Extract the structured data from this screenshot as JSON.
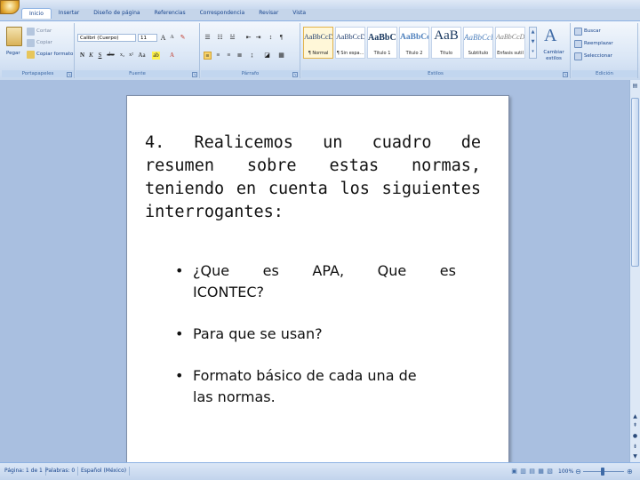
{
  "tabs": [
    "Inicio",
    "Insertar",
    "Diseño de página",
    "Referencias",
    "Correspondencia",
    "Revisar",
    "Vista"
  ],
  "active_tab": 0,
  "clipboard": {
    "paste": "Pegar",
    "cut": "Cortar",
    "copy": "Copiar",
    "format_painter": "Copiar formato",
    "label": "Portapapeles"
  },
  "font": {
    "name": "Calibri (Cuerpo)",
    "size": "11",
    "label": "Fuente"
  },
  "paragraph": {
    "label": "Párrafo"
  },
  "styles": {
    "label": "Estilos",
    "items": [
      {
        "sample": "AaBbCcDc",
        "name": "¶ Normal"
      },
      {
        "sample": "AaBbCcDc",
        "name": "¶ Sin espa..."
      },
      {
        "sample": "AaBbCc",
        "name": "Título 1"
      },
      {
        "sample": "AaBbCc",
        "name": "Título 2"
      },
      {
        "sample": "AaB",
        "name": "Título"
      },
      {
        "sample": "AaBbCcl",
        "name": "Subtítulo"
      },
      {
        "sample": "AaBbCcDc",
        "name": "Énfasis sutil"
      }
    ],
    "change_styles": "Cambiar estilos"
  },
  "editing": {
    "find": "Buscar",
    "replace": "Reemplazar",
    "select": "Seleccionar",
    "label": "Edición"
  },
  "document": {
    "paragraph": "4. Realicemos un cuadro de resumen sobre estas normas, teniendo en cuenta los siguientes interrogantes:",
    "bullet1_words": [
      "¿Que",
      "es",
      "APA,",
      "Que",
      "es"
    ],
    "bullet1_line2": "ICONTEC?",
    "bullet2": "Para que se usan?",
    "bullet3_line1": "Formato básico de cada una de",
    "bullet3_line2": "las normas.",
    "bullet_char": "•"
  },
  "status": {
    "page": "Página: 1 de 1",
    "words": "Palabras: 0",
    "language": "Español (México)",
    "zoom": "100%"
  }
}
